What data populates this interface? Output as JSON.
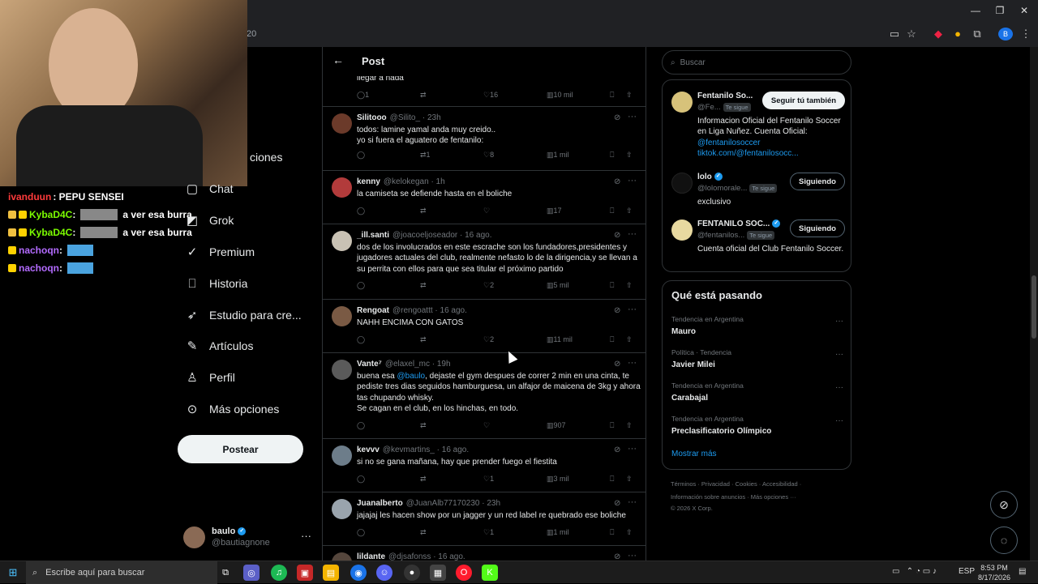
{
  "browser": {
    "address_fragment": "20",
    "window_controls": [
      "—",
      "❐",
      "✕"
    ]
  },
  "chat": [
    {
      "user": "ivanduun",
      "message": ": PEPU SENSEI",
      "kind": "text"
    },
    {
      "user": "KybaD4C",
      "message": "a ver esa burra",
      "kind": "emote"
    },
    {
      "user": "KybaD4C",
      "message": "a ver esa burra",
      "kind": "emote"
    },
    {
      "user": "nachoqn",
      "message": "",
      "kind": "emote2"
    },
    {
      "user": "nachoqn",
      "message": "",
      "kind": "emote2"
    }
  ],
  "nav": {
    "items": [
      {
        "label": "ciones",
        "icon": "notifications-icon"
      },
      {
        "label": "Chat",
        "icon": "chat-icon"
      },
      {
        "label": "Grok",
        "icon": "grok-icon"
      },
      {
        "label": "Premium",
        "icon": "premium-icon"
      },
      {
        "label": "Historia",
        "icon": "bookmark-icon"
      },
      {
        "label": "Estudio para cre...",
        "icon": "rocket-icon"
      },
      {
        "label": "Artículos",
        "icon": "articles-icon"
      },
      {
        "label": "Perfil",
        "icon": "person-icon"
      },
      {
        "label": "Más opciones",
        "icon": "more-circle-icon"
      }
    ],
    "post_button": "Postear"
  },
  "profile": {
    "name": "baulo",
    "handle": "@bautiagnone"
  },
  "feed": {
    "title": "Post",
    "partial_text": "llegar a nada",
    "partial_actions": {
      "reply": "1",
      "repost": "",
      "like": "16",
      "views": "10 mil"
    },
    "tweets": [
      {
        "name": "Silitooo",
        "handle": "@Silito_",
        "time": "· 23h",
        "text": "todos: lamine yamal anda muy creido..\nyo si fuera el aguatero de fentanilo:",
        "reply": "",
        "repost": "1",
        "like": "8",
        "views": "1 mil",
        "avatar_color": "#6b3a2a"
      },
      {
        "name": "kenny",
        "handle": "@kelokegan",
        "time": "· 1h",
        "text": "la camiseta se defiende hasta en el boliche",
        "reply": "",
        "repost": "",
        "like": "",
        "views": "17",
        "avatar_color": "#b23b3b"
      },
      {
        "name": "_ill.santi",
        "handle": "@joacoeljoseador",
        "time": "· 16 ago.",
        "text": "dos de los involucrados en este escrache son los fundadores,presidentes y jugadores actuales del club, realmente nefasto lo de la dirigencia,y se llevan a su perrita con ellos para que sea titular el próximo partido",
        "reply": "",
        "repost": "",
        "like": "2",
        "views": "5 mil",
        "avatar_color": "#c9c2b4"
      },
      {
        "name": "Rengoat",
        "handle": "@rengoattt",
        "time": "· 16 ago.",
        "text": "NAHH ENCIMA CON GATOS",
        "reply": "",
        "repost": "",
        "like": "2",
        "views": "11 mil",
        "avatar_color": "#7a5a44"
      },
      {
        "name": "Vante⁷",
        "handle": "@elaxel_mc",
        "time": "· 19h",
        "text_parts": [
          "buena esa ",
          "@baulo",
          ", dejaste el gym despues de correr 2 min en una cinta, te pediste tres dias seguidos hamburguesa, un alfajor de maicena de 3kg y ahora tas chupando whisky.\nSe cagan en el club, en los hinchas, en todo."
        ],
        "reply": "",
        "repost": "",
        "like": "",
        "views": "907",
        "avatar_color": "#5a5a5a"
      },
      {
        "name": "kevvv",
        "handle": "@kevmartins_",
        "time": "· 16 ago.",
        "text": "si no se gana mañana, hay que prender fuego el fiestita",
        "reply": "",
        "repost": "",
        "like": "1",
        "views": "3 mil",
        "avatar_color": "#6d7d8a"
      },
      {
        "name": "Juanalberto",
        "handle": "@JuanAlb77170230",
        "time": "· 23h",
        "text": "jajajaj les hacen show por un jagger y un red label re quebrado ese boliche",
        "reply": "",
        "repost": "",
        "like": "1",
        "views": "1 mil",
        "avatar_color": "#9aa4ad"
      },
      {
        "name": "lildante",
        "handle": "@djsafonss",
        "time": "· 16 ago.",
        "text": "",
        "reply": "",
        "repost": "",
        "like": "",
        "views": "",
        "avatar_color": "#55463c"
      }
    ]
  },
  "right": {
    "search_placeholder": "Buscar",
    "accounts": [
      {
        "name": "Fentanilo So...",
        "handle": "@Fe...",
        "tag": "Te sigue",
        "button": "Seguir tú también",
        "bio": "Informacion Oficial del Fentanilo Soccer en Liga Nuñez. Cuenta Oficial:",
        "bio_link1": "@fentanilosoccer",
        "bio_link2": "tiktok.com/@fentanilosocc...",
        "avatar_color": "#d7c27a"
      },
      {
        "name": "lolo",
        "handle": "@lolomorale...",
        "tag": "Te sigue",
        "button": "Siguiendo",
        "bio": "exclusivo",
        "avatar_color": "#111111"
      },
      {
        "name": "FENTANILO SOC...",
        "handle": "@fentanilos...",
        "tag": "Te sigue",
        "button": "Siguiendo",
        "bio": "Cuenta oficial del Club Fentanilo Soccer.",
        "avatar_color": "#e8d9a0"
      }
    ],
    "trends_title": "Qué está pasando",
    "trends": [
      {
        "context": "Tendencia en Argentina",
        "name": "Mauro"
      },
      {
        "context": "Política · Tendencia",
        "name": "Javier Milei"
      },
      {
        "context": "Tendencia en Argentina",
        "name": "Carabajal"
      },
      {
        "context": "Tendencia en Argentina",
        "name": "Preclasificatorio Olímpico"
      }
    ],
    "show_more": "Mostrar más",
    "footer_line1": "Términos · Privacidad · Cookies · Accesibilidad ·",
    "footer_line2": "Información sobre anuncios · Más opciones ···",
    "footer_line3": "© 2026 X Corp."
  },
  "taskbar": {
    "search_placeholder": "Escribe aquí para buscar",
    "lang": "ESP",
    "time": "8:53 PM",
    "date": "8/17/2026"
  }
}
